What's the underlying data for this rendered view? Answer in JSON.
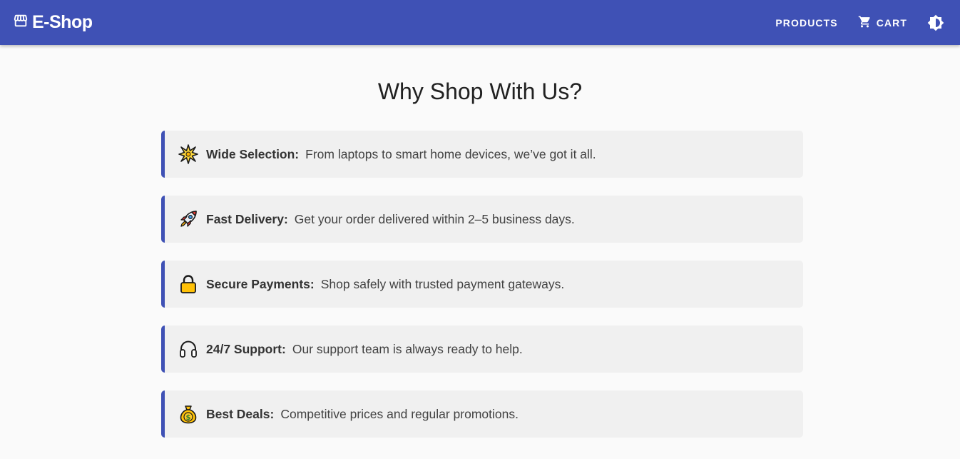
{
  "header": {
    "brand_title": "E-Shop",
    "brand_icon": "storefront-icon",
    "nav": {
      "products_label": "PRODUCTS",
      "cart_label": "CART",
      "cart_icon": "shopping-cart-icon",
      "theme_icon": "brightness-icon"
    },
    "colors": {
      "appbar": "#3f51b5",
      "text": "#ffffff"
    }
  },
  "main": {
    "title": "Why Shop With Us?",
    "accent_color": "#3f51b5",
    "features": [
      {
        "icon": "sparkle-burst-icon",
        "label": "Wide Selection:",
        "text": "From laptops to smart home devices, we’ve got it all."
      },
      {
        "icon": "rocket-icon",
        "label": "Fast Delivery:",
        "text": "Get your order delivered within 2–5 business days."
      },
      {
        "icon": "lock-icon",
        "label": "Secure Payments:",
        "text": "Shop safely with trusted payment gateways."
      },
      {
        "icon": "headphones-icon",
        "label": "24/7 Support:",
        "text": "Our support team is always ready to help."
      },
      {
        "icon": "money-bag-icon",
        "label": "Best Deals:",
        "text": "Competitive prices and regular promotions."
      }
    ]
  }
}
